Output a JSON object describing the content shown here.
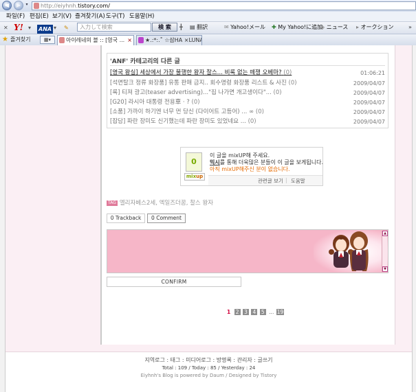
{
  "browser": {
    "back_glyph": "◀",
    "forward_glyph": "▶",
    "address_prefix": "http://",
    "address_sub": "eiyhnh.",
    "address_domain": "tistory.com/",
    "menu": [
      "파일(F)",
      "편집(E)",
      "보기(V)",
      "즐겨찾기(A)",
      "도구(T)",
      "도움말(H)"
    ],
    "toolbar": {
      "close": "✕",
      "yahoo": "Y!",
      "ana": "ANA",
      "search_placeholder": "入力して検索",
      "search_button": "検 索",
      "translate": "翻訳",
      "yahoo_mail": "Yahoo!メール",
      "my_yahoo": "My Yahoo!に追加",
      "news": "ニュース",
      "auction": "オークション"
    },
    "favorites_label": "즐겨찾기",
    "tab_grid": "▦▾",
    "tabs": [
      {
        "title": "아이레네의 블 :: [영국 ...",
        "close": "×"
      },
      {
        "title": "★.:*:.˚ ☆삼HA ×LUNAparkIS ...",
        "close": ""
      }
    ]
  },
  "category": {
    "title": "'ANF' 카테고리의 다른 글",
    "posts": [
      {
        "title": "[영국 왕실] 세상에서 가장 불행한 왕자 찰스... 비록 없는 떼쟁 오베마?",
        "count": "(0)",
        "date": "01:06:21"
      },
      {
        "title": "[석면탈크 정류 화장품] 유통 판매 금지.. 회수명령 화장품 리스트 & 사진",
        "count": "(0)",
        "date": "2009/04/07"
      },
      {
        "title": "[록] 티져 광고(teaser advertising)...\"집 나가면 개고생이다\"...",
        "count": "(0)",
        "date": "2009/04/07"
      },
      {
        "title": "[G20] 라시아 대통령 전용車 · ?",
        "count": "(0)",
        "date": "2009/04/07"
      },
      {
        "title": "[소품] 가까이 하기엔 너무 먼 당신 (다이어트 고등어) ... ∞",
        "count": "(0)",
        "date": "2009/04/07"
      },
      {
        "title": "[잡담] 파란 장미도 신기했는데 파란 장미도 있었네요 ...",
        "count": "(0)",
        "date": "2009/04/07"
      }
    ]
  },
  "mixup": {
    "icon_text": "0",
    "logo_mix": "mix",
    "logo_up": "up",
    "line1": "이 글을 mixUP해 주세요.",
    "line2_link": "믹시",
    "line2_rest": "를 통해 더욱많은 분들이 이 글을 보게됩니다.",
    "line3": "아직 mixUP해주신 분이 없습니다.",
    "related_link": "관련글 보기",
    "help_link": "도움말"
  },
  "tags": {
    "badge": "TAG",
    "text": "엘리자베스2세, 엑일즈더꿈, 찰스 왕자"
  },
  "buttons": {
    "trackback": "0 Trackback",
    "comment": "0 Comment",
    "confirm": "CONFIRM"
  },
  "pager": {
    "current": "1",
    "pages": [
      "2",
      "3",
      "4",
      "5"
    ],
    "dots": "...",
    "last": "19"
  },
  "footer": {
    "links": "지역로그 : 태그 : 미디어로그 : 방명록 : 관리자 : 글쓰기",
    "stats": "Total : 109 / Today : 85 / Yesterday : 24",
    "credit": "Eiyhnh's Blog is powered by Daum / Designed by Tistory"
  }
}
